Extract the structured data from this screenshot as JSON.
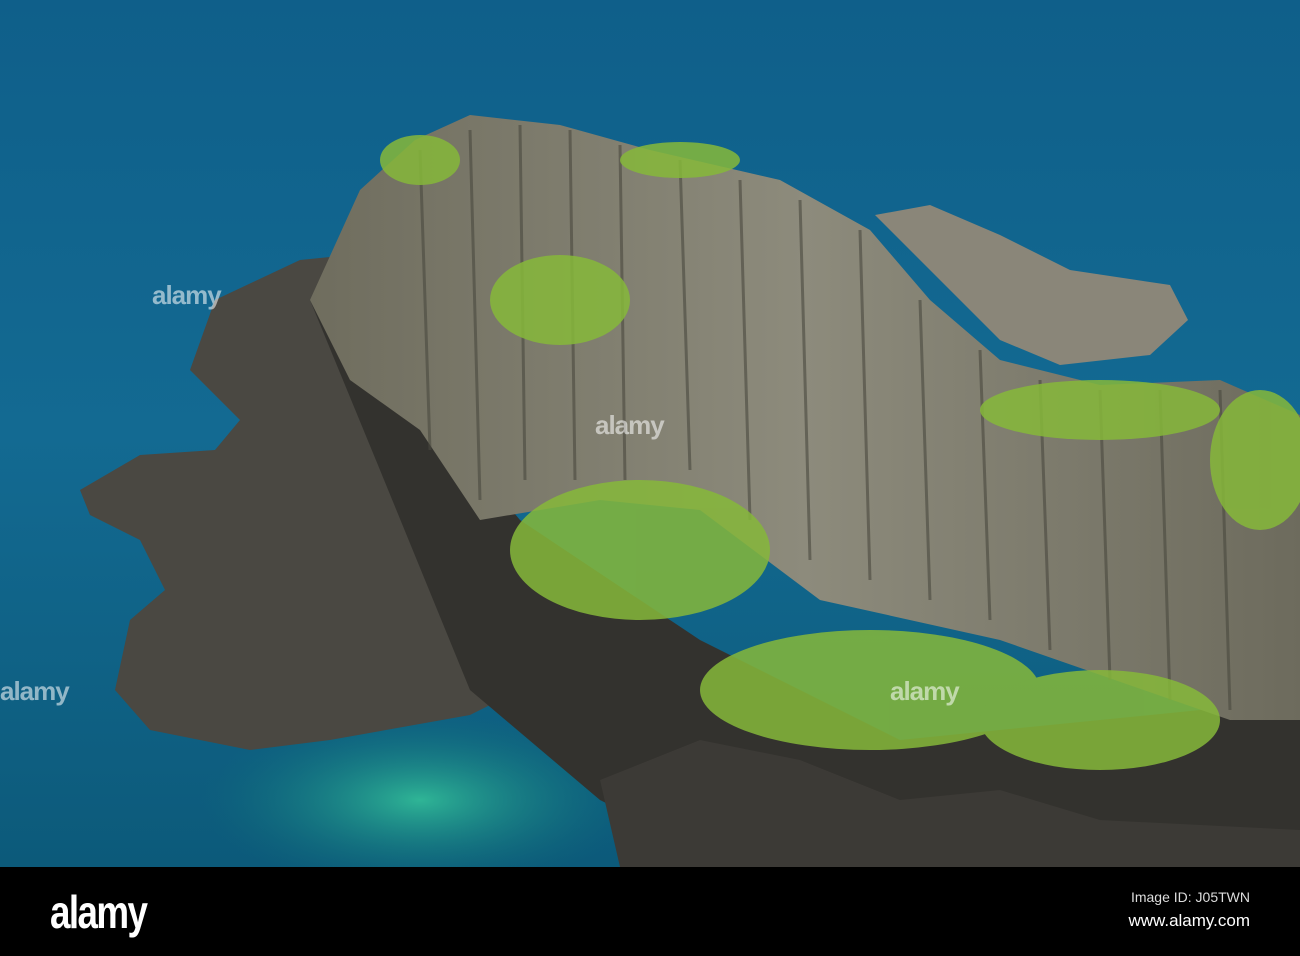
{
  "photo": {
    "subject": "basalt sea stack island",
    "colors": {
      "sea_deep": "#0e5a83",
      "sea_light": "#2a8cb0",
      "lagoon": "#1fa58a",
      "rock": "#7d7a6c",
      "rock_dark": "#3a3833",
      "grass": "#8bbd3c"
    }
  },
  "watermark": {
    "text": "alamy"
  },
  "footer": {
    "logo": "alamy",
    "image_id": "Image ID: J05TWN",
    "website": "www.alamy.com"
  }
}
